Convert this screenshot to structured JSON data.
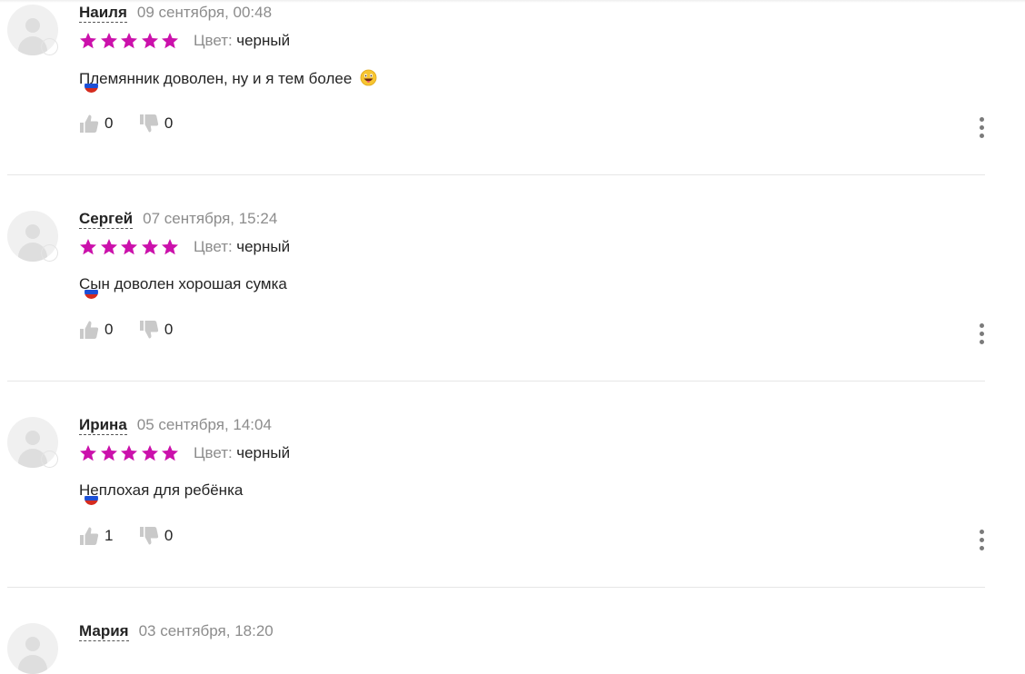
{
  "reviews": [
    {
      "author": "Наиля",
      "date": "09 сентября, 00:48",
      "rating": 5,
      "color_label": "Цвет:",
      "color_value": "черный",
      "text": "Племянник доволен, ну и я тем более",
      "emoji": "smiling-face-with-tongue",
      "likes": "0",
      "dislikes": "0"
    },
    {
      "author": "Сергей",
      "date": "07 сентября, 15:24",
      "rating": 5,
      "color_label": "Цвет:",
      "color_value": "черный",
      "text": "Сын доволен хорошая сумка",
      "likes": "0",
      "dislikes": "0"
    },
    {
      "author": "Ирина",
      "date": "05 сентября, 14:04",
      "rating": 5,
      "color_label": "Цвет:",
      "color_value": "черный",
      "text": "Неплохая для ребёнка",
      "likes": "1",
      "dislikes": "0"
    },
    {
      "author": "Мария",
      "date": "03 сентября, 18:20"
    }
  ],
  "colors": {
    "star": "#cb11ab",
    "muted_text": "#8c8c8c",
    "icon_gray": "#c9c9c9",
    "divider": "#e6e6e6"
  },
  "icons": {
    "like": "thumb-up-icon",
    "dislike": "thumb-down-icon",
    "more": "kebab-menu-icon",
    "flag": "russia-flag-icon"
  }
}
